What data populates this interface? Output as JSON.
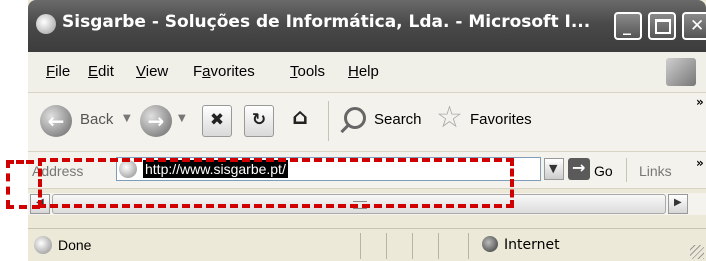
{
  "window": {
    "title": "Sisgarbe - Soluções de Informática, Lda. - Microsoft I...",
    "controls": {
      "minimize": "_",
      "maximize": "□",
      "close": "X"
    }
  },
  "menubar": {
    "items": [
      {
        "pre": "",
        "key": "F",
        "post": "ile"
      },
      {
        "pre": "",
        "key": "E",
        "post": "dit"
      },
      {
        "pre": "",
        "key": "V",
        "post": "iew"
      },
      {
        "pre": "F",
        "key": "a",
        "post": "vorites"
      },
      {
        "pre": "",
        "key": "T",
        "post": "ools"
      },
      {
        "pre": "",
        "key": "H",
        "post": "elp"
      }
    ]
  },
  "toolbar": {
    "back_label": "Back",
    "search_label": "Search",
    "favorites_label": "Favorites",
    "overflow": "»"
  },
  "addressbar": {
    "label": "Address",
    "url": "http://www.sisgarbe.pt/",
    "go_label": "Go",
    "links_label": "Links",
    "links_overflow": "»"
  },
  "statusbar": {
    "status": "Done",
    "zone": "Internet"
  },
  "highlight": {
    "color": "#d00000"
  }
}
